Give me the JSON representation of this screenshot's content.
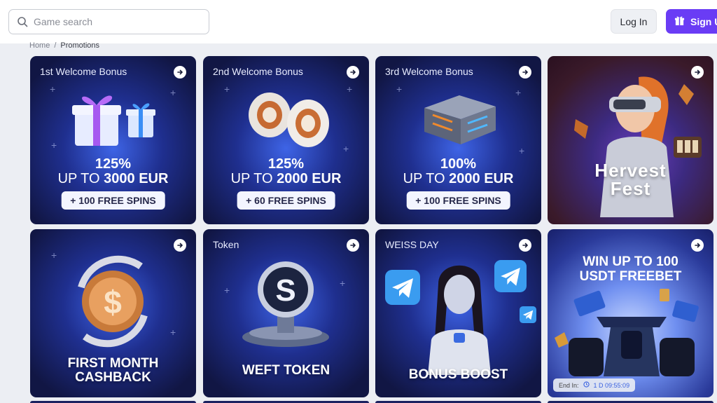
{
  "search": {
    "placeholder": "Game search"
  },
  "header": {
    "login_label": "Log In",
    "signup_label": "Sign Up"
  },
  "breadcrumb": {
    "home": "Home",
    "separator": "/",
    "current": "Promotions"
  },
  "promotions": [
    {
      "title": "1st Welcome Bonus",
      "percent": "125%",
      "up_to": "UP TO",
      "amount": "3000 EUR",
      "spins": "+ 100 FREE SPINS"
    },
    {
      "title": "2nd Welcome Bonus",
      "percent": "125%",
      "up_to": "UP TO",
      "amount": "2000 EUR",
      "spins": "+ 60 FREE SPINS"
    },
    {
      "title": "3rd Welcome Bonus",
      "percent": "100%",
      "up_to": "UP TO",
      "amount": "2000 EUR",
      "spins": "+ 100 FREE SPINS"
    },
    {
      "title": "",
      "logo_text_1": "Hervest",
      "logo_text_2": "Fest"
    },
    {
      "title": "",
      "caption_1": "FIRST MONTH",
      "caption_2": "CASHBACK"
    },
    {
      "title": "Token",
      "caption_1": "WEFT TOKEN"
    },
    {
      "title": "WEISS DAY",
      "caption_1": "BONUS BOOST"
    },
    {
      "title": "",
      "caption_1": "WIN UP TO 100",
      "caption_2": "USDT FREEBET",
      "end_in_label": "End In:",
      "end_in_time": "1 D 09:55:09"
    }
  ],
  "colors": {
    "accent": "#6a3cf5",
    "card_dark": "#121a4a",
    "card_glow": "#3f6df2"
  }
}
